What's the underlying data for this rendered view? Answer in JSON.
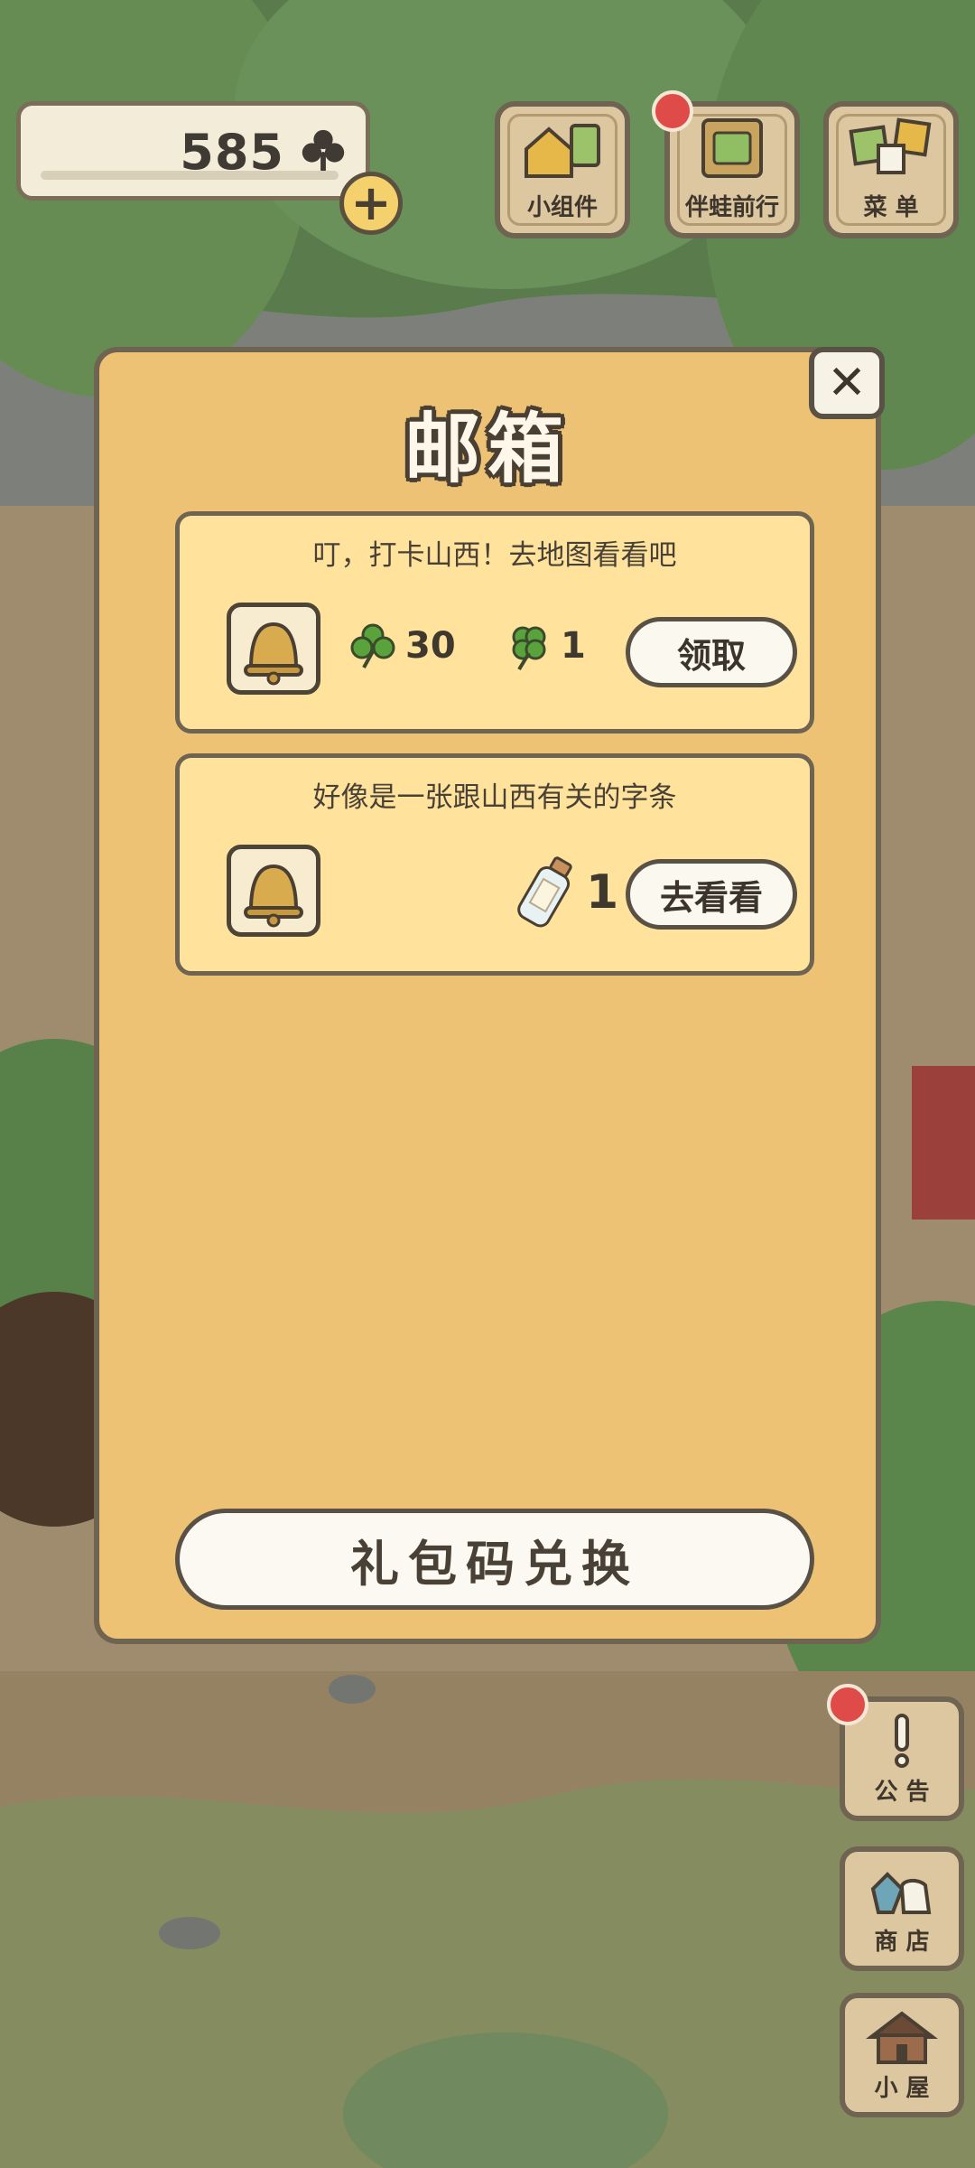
{
  "header": {
    "clover_count": "585",
    "add_symbol": "+"
  },
  "top_tiles": [
    {
      "label": "小组件",
      "icon": "widget-icon",
      "badge": false
    },
    {
      "label": "伴蛙前行",
      "icon": "frog-companion-icon",
      "badge": true
    },
    {
      "label": "菜 单",
      "icon": "menu-icon",
      "badge": false
    }
  ],
  "mailbox": {
    "title": "邮箱",
    "close_symbol": "✕",
    "messages": [
      {
        "text": "叮，打卡山西！去地图看看吧",
        "rewards": [
          {
            "icon": "clover-icon",
            "qty": "30"
          },
          {
            "icon": "four-leaf-clover-icon",
            "qty": "1"
          }
        ],
        "action": "领取"
      },
      {
        "text": "好像是一张跟山西有关的字条",
        "rewards": [
          {
            "icon": "message-bottle-icon",
            "qty": "1"
          }
        ],
        "action": "去看看"
      }
    ],
    "redeem_label": "礼包码兑换"
  },
  "side_tiles": [
    {
      "label": "公 告",
      "icon": "announcement-icon",
      "badge": true
    },
    {
      "label": "商 店",
      "icon": "shop-icon",
      "badge": false
    },
    {
      "label": "小 屋",
      "icon": "house-icon",
      "badge": false
    }
  ],
  "colors": {
    "modal_bg": "#eec274",
    "card_bg": "#ffe39d",
    "outline": "#6f6452",
    "badge_red": "#de4b49"
  }
}
